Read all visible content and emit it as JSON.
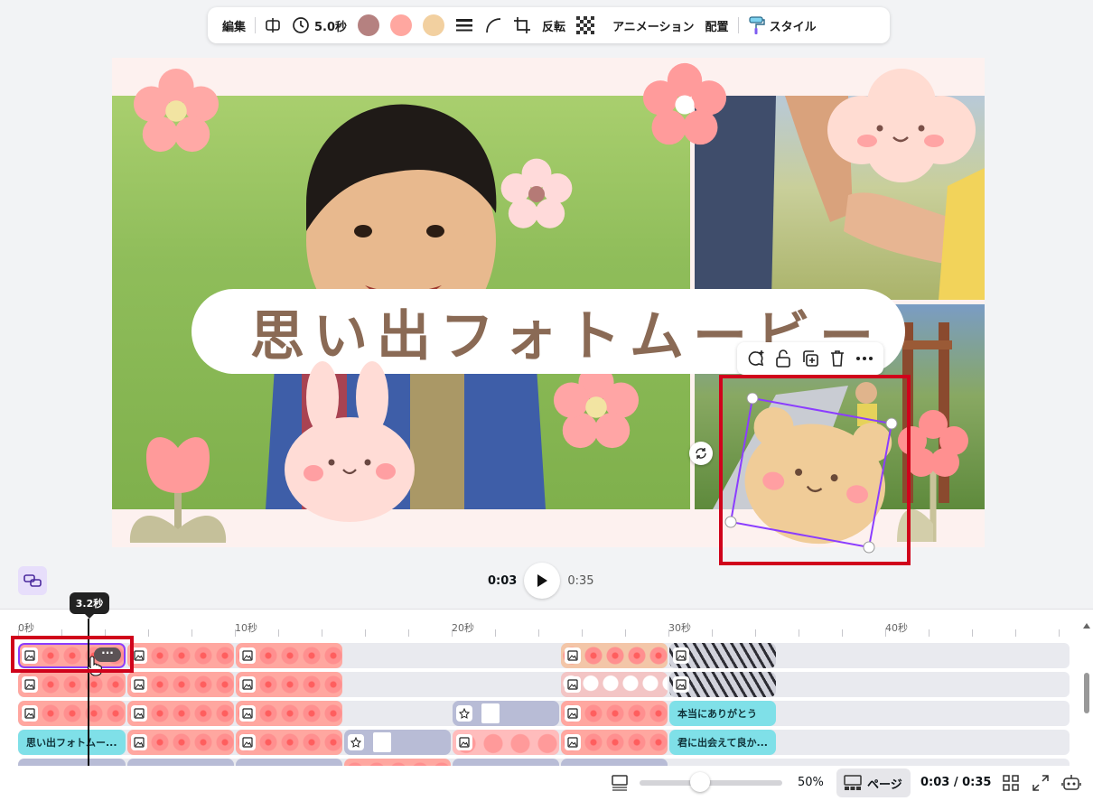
{
  "toolbar": {
    "edit": "編集",
    "duration": "5.0秒",
    "colors": [
      "#b58180",
      "#ffa7a0",
      "#f2d0a0"
    ],
    "flip": "反転",
    "animation": "アニメーション",
    "position": "配置",
    "style": "スタイル"
  },
  "canvas": {
    "title": "思い出フォトムービー"
  },
  "playback": {
    "current": "0:03",
    "total": "0:35",
    "tooltip": "3.2秒"
  },
  "timeline": {
    "ruler": [
      "0秒",
      "10秒",
      "20秒",
      "30秒",
      "40秒"
    ],
    "text_clips": {
      "thanks": "本当にありがとう",
      "title": "思い出フォトムー...",
      "met": "君に出会えて良か..."
    },
    "more": "···"
  },
  "footer": {
    "zoom": "50%",
    "page": "ページ",
    "time": "0:03 / 0:35"
  }
}
